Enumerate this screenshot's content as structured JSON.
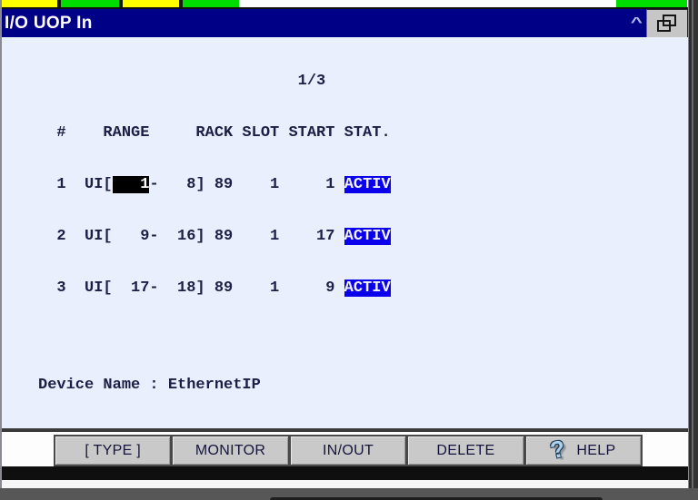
{
  "title_bar": {
    "title": "I/O UOP In",
    "collapse_caret": "^"
  },
  "io_table": {
    "page_indicator": "1/3",
    "header": "  #    RANGE     RACK SLOT START STAT.",
    "rows": [
      {
        "prefix": "  1  UI[",
        "cursor_field": "   1",
        "rest": "-   8] 89    1     1 ",
        "status": "ACTIV"
      },
      {
        "text": "  2  UI[   9-  16] 89    1    17 ",
        "status": "ACTIV"
      },
      {
        "text": "  3  UI[  17-  18] 89    1     9 ",
        "status": "ACTIV"
      }
    ]
  },
  "device_name_line": "Device Name : EthernetIP",
  "function_keys": {
    "labels": [
      "[ TYPE ]",
      "MONITOR",
      "IN/OUT",
      "DELETE",
      "HELP"
    ],
    "help_icon": "?"
  },
  "colors": {
    "title_bar_bg": "#000087",
    "screen_bg": "#e9effc",
    "status_active_bg": "#0b00ec",
    "cursor_bg": "#000000",
    "led_yellow": "#ffff00",
    "led_green": "#00dd00"
  }
}
